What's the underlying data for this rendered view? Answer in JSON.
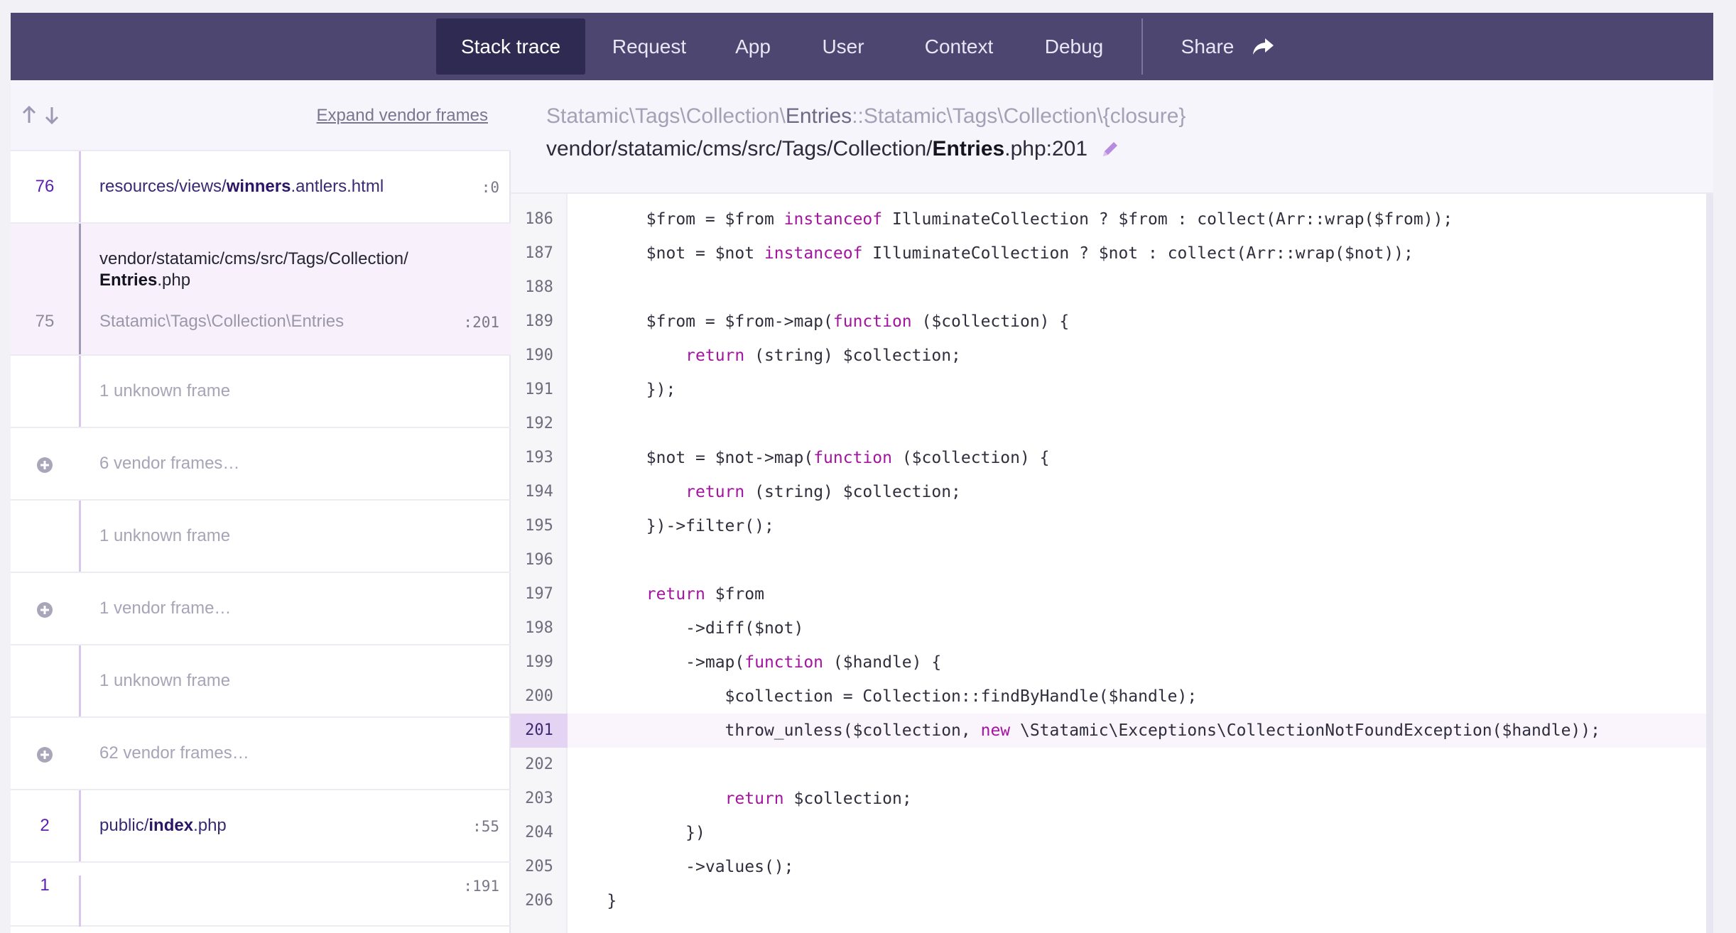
{
  "tabs": {
    "items": [
      {
        "label": "Stack trace",
        "active": true
      },
      {
        "label": "Request",
        "active": false
      },
      {
        "label": "App",
        "active": false
      },
      {
        "label": "User",
        "active": false
      },
      {
        "label": "Context",
        "active": false
      },
      {
        "label": "Debug",
        "active": false
      }
    ],
    "share_label": "Share"
  },
  "stack": {
    "expand_label": "Expand vendor frames",
    "frames": [
      {
        "kind": "app",
        "number": "76",
        "path_prefix": "resources/views/",
        "path_bold": "winners",
        "path_suffix": ".antlers.html",
        "line": ":0"
      },
      {
        "kind": "selected",
        "number": "75",
        "path_line1": "vendor/statamic/cms/src/Tags/Collection/",
        "path_bold": "Entries",
        "path_suffix": ".php",
        "class": "Statamic\\Tags\\Collection\\Entries",
        "line": ":201"
      },
      {
        "kind": "unknown",
        "label": "1 unknown frame"
      },
      {
        "kind": "vendor",
        "label": "6 vendor frames…"
      },
      {
        "kind": "unknown",
        "label": "1 unknown frame"
      },
      {
        "kind": "vendor",
        "label": "1 vendor frame…"
      },
      {
        "kind": "unknown",
        "label": "1 unknown frame"
      },
      {
        "kind": "vendor",
        "label": "62 vendor frames…"
      },
      {
        "kind": "app",
        "number": "2",
        "path_prefix": "public/",
        "path_bold": "index",
        "path_suffix": ".php",
        "line": ":55"
      },
      {
        "kind": "app",
        "number": "1",
        "path_prefix": "",
        "path_bold": "",
        "path_suffix": "",
        "line": ":191"
      }
    ]
  },
  "frame_header": {
    "class_prefix": "Statamic\\Tags\\Collection\\",
    "class_bold": "Entries",
    "class_suffix": "::Statamic\\Tags\\Collection\\{closure}",
    "file_prefix": "vendor/statamic/cms/src/Tags/Collection/",
    "file_bold": "Entries",
    "file_suffix": ".php:201"
  },
  "code": {
    "highlight_line": 201,
    "lines": [
      {
        "n": "186",
        "text": "        $from = $from instanceof IlluminateCollection ? $from : collect(Arr::wrap($from));"
      },
      {
        "n": "187",
        "text": "        $not = $not instanceof IlluminateCollection ? $not : collect(Arr::wrap($not));"
      },
      {
        "n": "188",
        "text": ""
      },
      {
        "n": "189",
        "text": "        $from = $from->map(function ($collection) {"
      },
      {
        "n": "190",
        "text": "            return (string) $collection;"
      },
      {
        "n": "191",
        "text": "        });"
      },
      {
        "n": "192",
        "text": ""
      },
      {
        "n": "193",
        "text": "        $not = $not->map(function ($collection) {"
      },
      {
        "n": "194",
        "text": "            return (string) $collection;"
      },
      {
        "n": "195",
        "text": "        })->filter();"
      },
      {
        "n": "196",
        "text": ""
      },
      {
        "n": "197",
        "text": "        return $from"
      },
      {
        "n": "198",
        "text": "            ->diff($not)"
      },
      {
        "n": "199",
        "text": "            ->map(function ($handle) {"
      },
      {
        "n": "200",
        "text": "                $collection = Collection::findByHandle($handle);"
      },
      {
        "n": "201",
        "text": "                throw_unless($collection, new \\Statamic\\Exceptions\\CollectionNotFoundException($handle));"
      },
      {
        "n": "202",
        "text": ""
      },
      {
        "n": "203",
        "text": "                return $collection;"
      },
      {
        "n": "204",
        "text": "            })"
      },
      {
        "n": "205",
        "text": "            ->values();"
      },
      {
        "n": "206",
        "text": "    }"
      }
    ]
  },
  "colors": {
    "nav_bg": "#4c4670",
    "active_tab_bg": "#2f2a52",
    "keyword": "#a3159e",
    "highlight_gutter": "#e5d3f4"
  }
}
